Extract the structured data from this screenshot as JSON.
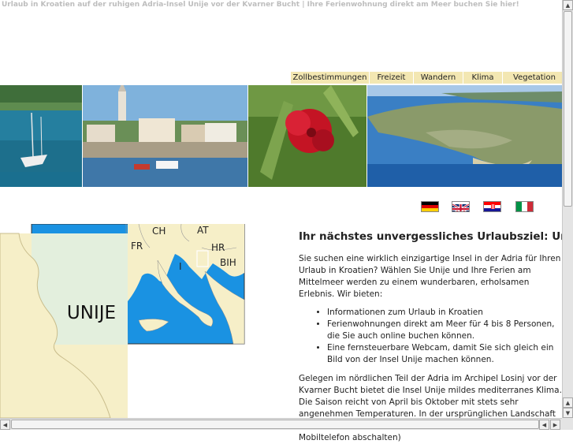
{
  "header": {
    "tagline": "Urlaub in Kroatien auf der ruhigen Adria-Insel Unije vor der Kvarner Bucht | Ihre Ferienwohnung direkt am Meer buchen Sie hier!"
  },
  "nav": {
    "items": [
      {
        "label": "Zollbestimmungen"
      },
      {
        "label": "Freizeit"
      },
      {
        "label": "Wandern"
      },
      {
        "label": "Klima"
      },
      {
        "label": "Vegetation"
      }
    ]
  },
  "languages": [
    {
      "name": "german-flag-icon"
    },
    {
      "name": "uk-flag-icon"
    },
    {
      "name": "croatian-flag-icon"
    },
    {
      "name": "italian-flag-icon"
    }
  ],
  "map": {
    "island_label": "UNIJE",
    "country_labels": [
      "CH",
      "AT",
      "FR",
      "HR",
      "I",
      "BIH"
    ]
  },
  "main": {
    "heading": "Ihr nächstes unvergessliches Urlaubsziel: Unije",
    "intro": "Sie suchen eine wirklich einzigartige Insel in der Adria für Ihren Urlaub in Kroatien? Wählen Sie Unije und Ihre Ferien am Mittelmeer werden zu einem wunderbaren, erholsamen Erlebnis. Wir bieten:",
    "bullets": [
      "Informationen zum Urlaub in Kroatien",
      "Ferienwohnungen direkt am Meer für 4 bis 8 Personen, die Sie auch online buchen können.",
      "Eine fernsteuerbare Webcam, damit Sie sich gleich ein Bild von der Insel Unije machen können."
    ],
    "paragraph2": "Gelegen im nördlichen Teil der Adria im Archipel Losinj vor der Kvarner Bucht bietet die Insel Unije mildes mediterranes Klima. Die Saison reicht von April bis Oktober mit stets sehr angenehmen Temperaturen. In der ursprünglichen Landschaft mit ihrer vielfältigen reinen Natur können Sie (sofern Sie Ihr Mobiltelefon abschalten)"
  },
  "colors": {
    "nav_bg": "#f3e7b2",
    "map_sea": "#1a92e2",
    "map_land": "#f6efc8",
    "tagline": "#bdbdbd"
  }
}
